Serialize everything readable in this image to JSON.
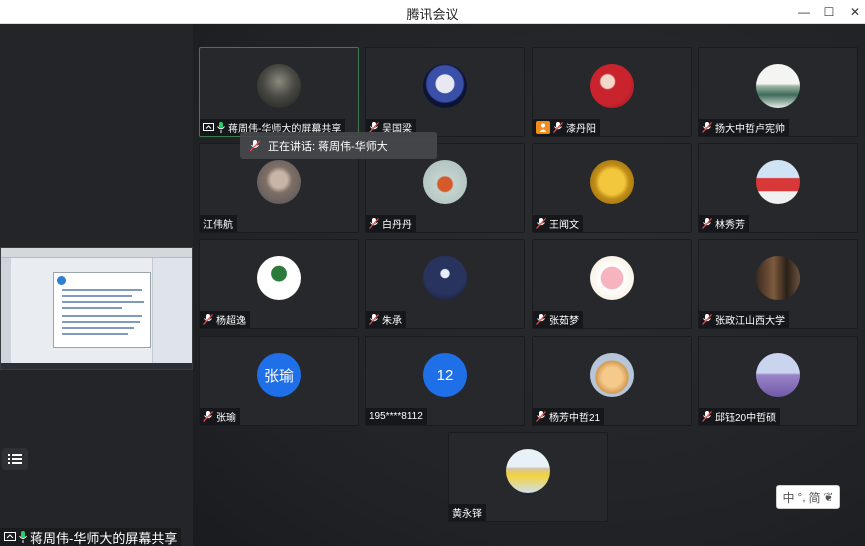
{
  "window": {
    "title": "腾讯会议",
    "min": "—",
    "max": "☐",
    "close": "✕"
  },
  "speaking_toast": "正在讲话: 蒋周伟-华师大",
  "bottom_label": "蒋周伟-华师大的屏幕共享",
  "ime": {
    "lang": "中",
    "dot": "°,",
    "mode": "简"
  },
  "participants": [
    {
      "name": "蒋周伟-华师大的屏幕共享",
      "avatar": "photo-dark",
      "screen": true,
      "mic": "on",
      "speaking": true
    },
    {
      "name": "吴国梁",
      "avatar": "astronaut",
      "mic": "muted"
    },
    {
      "name": "漆丹阳",
      "avatar": "red-scene",
      "mic": "muted",
      "badge": "orange"
    },
    {
      "name": "扬大中哲卢宪帅",
      "avatar": "landscape",
      "mic": "muted"
    },
    {
      "name": "江伟航",
      "avatar": "portrait",
      "mic": "none"
    },
    {
      "name": "白丹丹",
      "avatar": "fox",
      "mic": "muted"
    },
    {
      "name": "王闻文",
      "avatar": "gold-seal",
      "mic": "muted"
    },
    {
      "name": "林秀芳",
      "avatar": "person-red",
      "mic": "muted"
    },
    {
      "name": "杨超逸",
      "avatar": "tree-logo",
      "mic": "muted"
    },
    {
      "name": "朱承",
      "avatar": "night-moon",
      "mic": "muted"
    },
    {
      "name": "张茹梦",
      "avatar": "pig-cartoon",
      "mic": "muted"
    },
    {
      "name": "张政江山西大学",
      "avatar": "group-photo",
      "mic": "muted"
    },
    {
      "name": "张瑜",
      "avatar_text": "张瑜",
      "mic": "muted"
    },
    {
      "name": "195****8112",
      "avatar_text": "12",
      "mic": "none"
    },
    {
      "name": "杨芳中哲21",
      "avatar": "cat",
      "mic": "muted"
    },
    {
      "name": "邱钰20中哲硕",
      "avatar": "lavender",
      "mic": "muted"
    },
    {
      "name": "黄永铎",
      "avatar": "child-photo",
      "mic": "none"
    }
  ],
  "colors": {
    "avatar_blue": "#1e6fe8",
    "speaking_green": "#3e7b53",
    "mic_green": "#2ecc71",
    "badge_orange": "#f28a1c"
  }
}
